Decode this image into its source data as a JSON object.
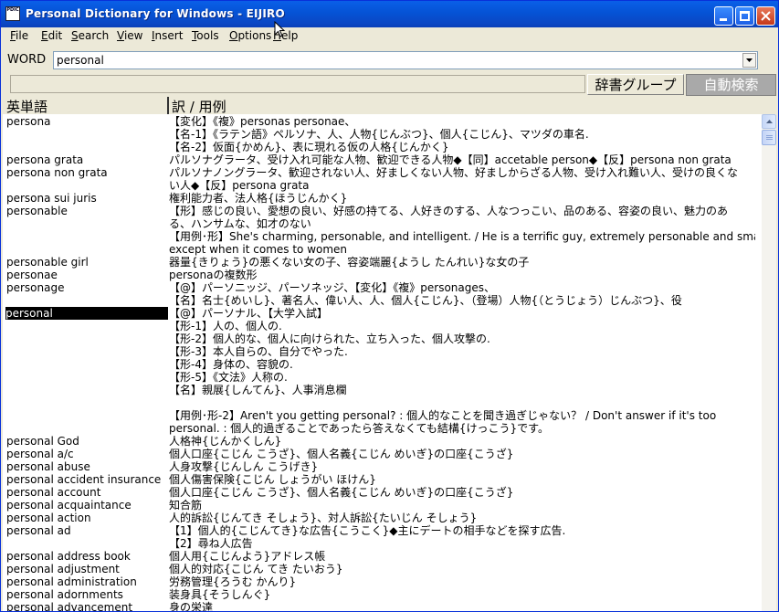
{
  "window": {
    "title": "Personal Dictionary for Windows - EIJIRO",
    "icon_text": "PDIC",
    "buttons": {
      "minimize": "minimize",
      "maximize": "maximize",
      "close": "close"
    }
  },
  "menu": [
    {
      "hotkey": "F",
      "rest": "ile"
    },
    {
      "hotkey": "E",
      "rest": "dit"
    },
    {
      "hotkey": "S",
      "rest": "earch"
    },
    {
      "hotkey": "V",
      "rest": "iew"
    },
    {
      "hotkey": "I",
      "rest": "nsert"
    },
    {
      "hotkey": "T",
      "rest": "ools"
    },
    {
      "hotkey": "O",
      "rest": "ptions"
    },
    {
      "hotkey": "H",
      "rest": "elp"
    }
  ],
  "search": {
    "label": "WORD",
    "value": "personal"
  },
  "toolbar": {
    "dict_group": "辞書グループ",
    "auto_search": "自動検索"
  },
  "columns": {
    "word": "英単語",
    "definition": "訳 / 用例"
  },
  "entries": [
    {
      "word": "persona",
      "lines": [
        "【変化】《複》personas personae、",
        "【名-1】《ラテン語》ペルソナ、人、人物{じんぶつ}、個人{こじん}、マツダの車名.",
        "【名-2】仮面{かめん}、表に現れる仮の人格{じんかく}"
      ]
    },
    {
      "word": "persona grata",
      "lines": [
        "パルソナグラータ、受け入れ可能な人物、歓迎できる人物◆【同】accetable person◆【反】persona non grata"
      ]
    },
    {
      "word": "persona non grata",
      "lines": [
        "パルソナノングラータ、歓迎されない人、好ましくない人物、好ましからざる人物、受け入れ難い人、受けの良くな",
        "い人◆【反】persona grata"
      ]
    },
    {
      "word": "persona sui juris",
      "lines": [
        "権利能力者、法人格{ほうじんかく}"
      ]
    },
    {
      "word": "personable",
      "lines": [
        "【形】感じの良い、愛想の良い、好感の持てる、人好きのする、人なつっこい、品のある、容姿の良い、魅力のあ",
        "る、ハンサムな、如才のない",
        "【用例･形】She's charming, personable, and intelligent. / He is a terrific guy, extremely personable and smart,",
        "except when it comes to women"
      ]
    },
    {
      "word": "personable girl",
      "lines": [
        "器量{きりょう}の悪くない女の子、容姿端麗{ようし たんれい}な女の子"
      ]
    },
    {
      "word": "personae",
      "lines": [
        "personaの複数形"
      ]
    },
    {
      "word": "personage",
      "lines": [
        "【@】パーソニッジ、パーソネッジ、【変化】《複》personages、",
        "【名】名士{めいし}、著名人、偉い人、人、個人{こじん}、（登場）人物{（とうじょう）じんぶつ}、役"
      ]
    },
    {
      "word": "personal",
      "selected": true,
      "lines": [
        "【@】パーソナル、【大学入試】",
        "【形-1】人の、個人の.",
        "【形-2】個人的な、個人に向けられた、立ち入った、個人攻撃の.",
        "【形-3】本人自らの、自分でやった.",
        "【形-4】身体の、容貌の.",
        "【形-5】《文法》人称の.",
        "【名】親展{しんてん}、人事消息欄",
        "",
        "【用例･形-2】Aren't you getting personal? : 個人的なことを聞き過ぎじゃない？ / Don't answer if it's too",
        "personal. : 個人的過ぎることであったら答えなくても結構{けっこう}です。"
      ]
    },
    {
      "word": "personal God",
      "lines": [
        "人格神{じんかくしん}"
      ]
    },
    {
      "word": "personal a/c",
      "lines": [
        "個人口座{こじん こうざ}、個人名義{こじん めいぎ}の口座{こうざ}"
      ]
    },
    {
      "word": "personal abuse",
      "lines": [
        "人身攻撃{じんしん こうげき}"
      ]
    },
    {
      "word": "personal accident insurance",
      "lines": [
        "個人傷害保険{こじん しょうがい ほけん}"
      ]
    },
    {
      "word": "personal account",
      "lines": [
        "個人口座{こじん こうざ}、個人名義{こじん めいぎ}の口座{こうざ}"
      ]
    },
    {
      "word": "personal acquaintance",
      "lines": [
        "知合筋"
      ]
    },
    {
      "word": "personal action",
      "lines": [
        "人的訴訟{じんてき そしょう}、対人訴訟{たいじん そしょう}"
      ]
    },
    {
      "word": "personal ad",
      "lines": [
        "【1】個人的{こじんてき}な広告{こうこく}◆主にデートの相手などを探す広告.",
        "【2】尋ね人広告"
      ]
    },
    {
      "word": "personal address book",
      "lines": [
        "個人用{こじんよう}アドレス帳"
      ]
    },
    {
      "word": "personal adjustment",
      "lines": [
        "個人的対応{こじん てき たいおう}"
      ]
    },
    {
      "word": "personal administration",
      "lines": [
        "労務管理{ろうむ かんり}"
      ]
    },
    {
      "word": "personal adornments",
      "lines": [
        "装身具{そうしんぐ}"
      ]
    },
    {
      "word": "personal advancement",
      "lines": [
        "身の栄達"
      ]
    }
  ]
}
